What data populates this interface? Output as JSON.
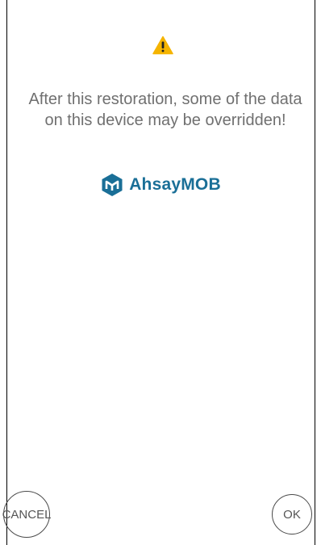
{
  "dialog": {
    "warning_icon": "warning-triangle-icon",
    "message": "After this restoration, some of the data on this device may be overridden!",
    "brand": {
      "logo_icon": "ahsay-logo-icon",
      "name": "AhsayMOB",
      "color": "#1a6f97"
    },
    "warning_color": "#f5b400",
    "text_color": "#707070"
  },
  "actions": {
    "cancel_label": "CANCEL",
    "ok_label": "OK"
  }
}
